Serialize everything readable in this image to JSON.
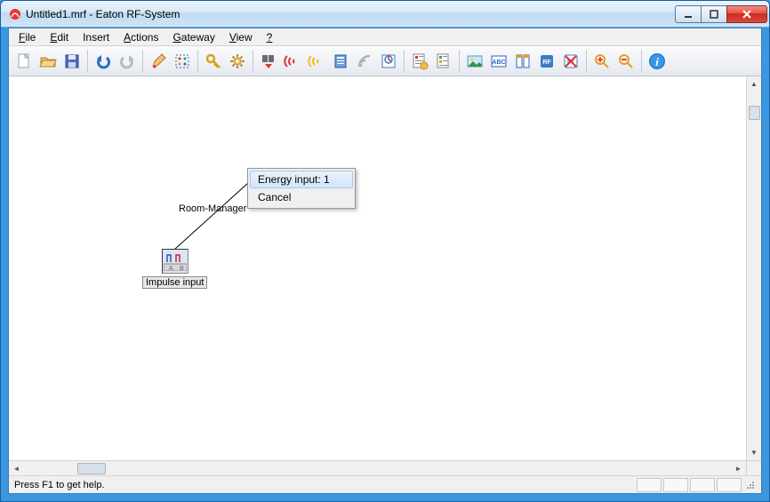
{
  "window": {
    "title": "Untitled1.mrf - Eaton RF-System"
  },
  "menus": {
    "file": "File",
    "edit": "Edit",
    "insert": "Insert",
    "actions": "Actions",
    "gateway": "Gateway",
    "view": "View",
    "help": "?"
  },
  "toolbar_icons": [
    "new-file",
    "open-file",
    "save-file",
    "sep",
    "undo",
    "redo",
    "sep",
    "pencil",
    "grid-select",
    "sep",
    "key",
    "gear",
    "sep",
    "barcode-down",
    "signal-red",
    "signal-yellow",
    "book",
    "rss-grey",
    "stats",
    "sep",
    "page-cfg",
    "page-edit",
    "sep",
    "image",
    "abc",
    "columns",
    "rf-badge",
    "rf-delete",
    "sep",
    "zoom-in",
    "zoom-out",
    "sep",
    "info"
  ],
  "context_menu": {
    "items": [
      {
        "label": "Energy input: 1",
        "hover": true
      },
      {
        "label": "Cancel",
        "hover": false
      }
    ]
  },
  "canvas": {
    "room_manager_label": "Room-Manager",
    "node_label": "Impulse input"
  },
  "statusbar": {
    "hint": "Press F1 to get help."
  },
  "icon_colors": {
    "new": "#ffffff",
    "open": "#e9a13c",
    "save": "#4f6fbf",
    "undo": "#2b6fbf",
    "redo": "#9aaec8",
    "pencil": "#d37f2a",
    "grid": "#3a67c8",
    "key": "#d6a317",
    "gear": "#e2a21c",
    "barcode": "#222222",
    "sigred": "#d83a2e",
    "sigyel": "#e7c11c",
    "book": "#3d7cc4",
    "rss": "#aab4be",
    "stats": "#3d7cc4",
    "image": "#3fa2d8",
    "abc": "#2d64c2",
    "cols": "#2d64c2",
    "rf": "#2d64c2",
    "rfdel": "#c33",
    "zoomin": "#e2a21c",
    "zoomout": "#e2a21c",
    "info": "#1e7ad6"
  }
}
